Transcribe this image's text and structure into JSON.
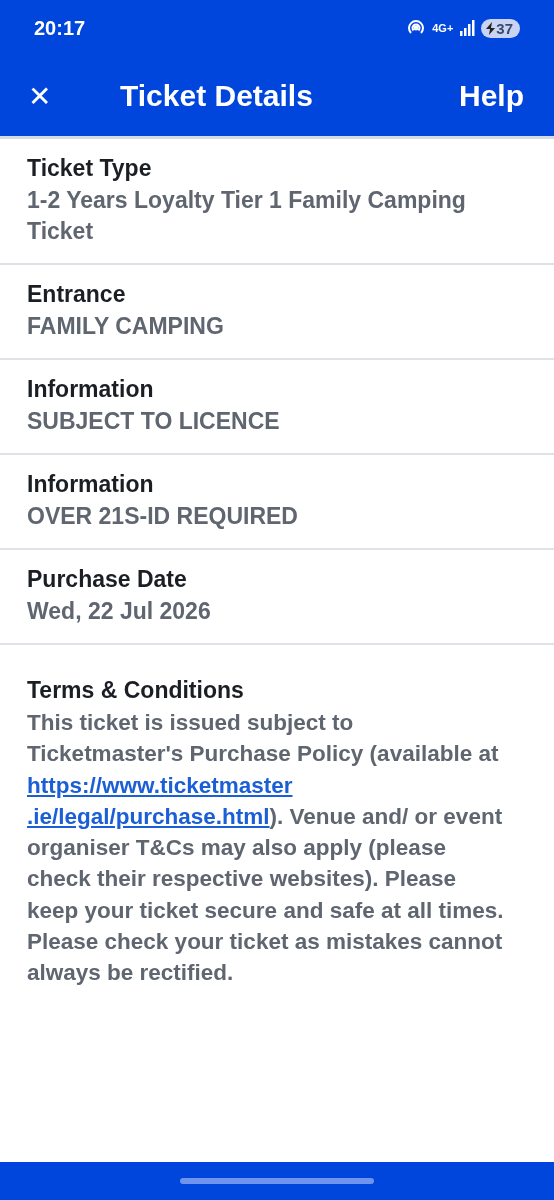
{
  "status_bar": {
    "time": "20:17",
    "network": "4G+",
    "battery": "37"
  },
  "app_bar": {
    "close": "✕",
    "title": "Ticket Details",
    "help": "Help"
  },
  "details": [
    {
      "label": "Ticket Type",
      "value": "1-2 Years Loyalty Tier 1 Family Camping Ticket"
    },
    {
      "label": "Entrance",
      "value": "FAMILY CAMPING"
    },
    {
      "label": "Information",
      "value": "SUBJECT TO LICENCE"
    },
    {
      "label": "Information",
      "value": "OVER 21S-ID REQUIRED"
    },
    {
      "label": "Purchase Date",
      "value": "Wed, 22 Jul 2026"
    }
  ],
  "terms": {
    "label": "Terms & Conditions",
    "text_before": "This ticket is issued subject to Ticketmaster's Purchase Policy (available at",
    "link_lines": [
      "https://www.ticketmaster",
      ".ie/legal/purchase.html"
    ],
    "text_after": "). Venue and/ or event organiser T&Cs may also apply (please check their respective websites). Please keep your ticket secure and safe at all times. Please check your ticket as mistakes cannot always be rectified."
  }
}
